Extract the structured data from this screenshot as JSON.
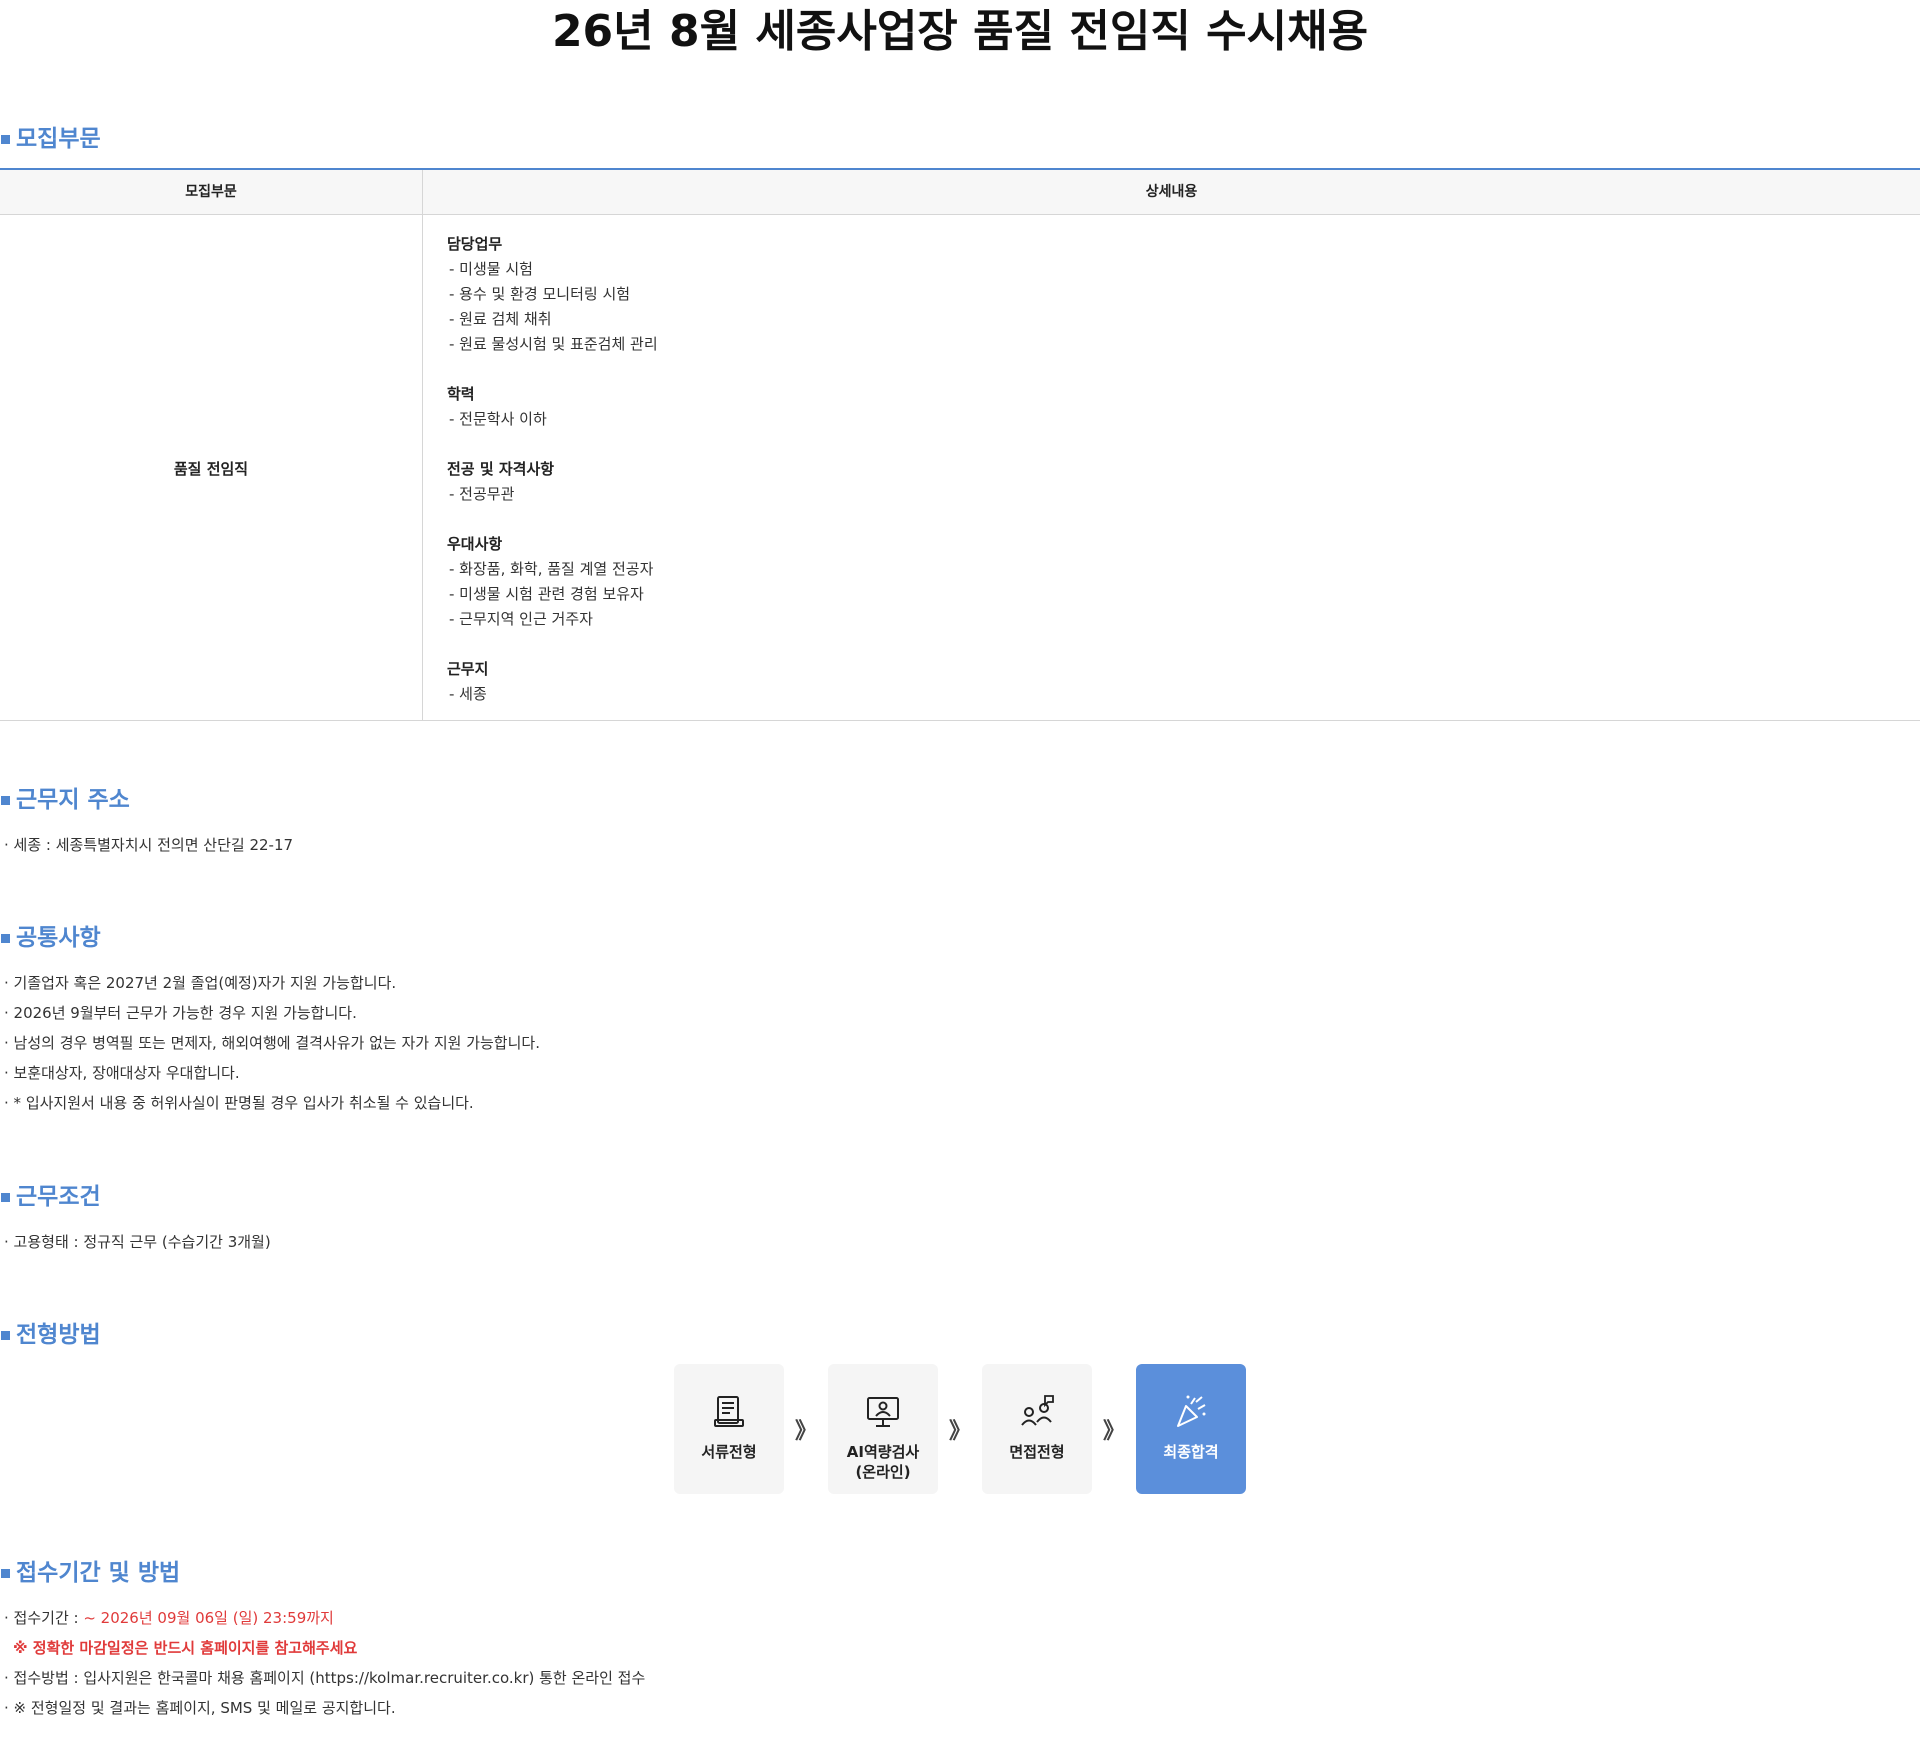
{
  "page": {
    "title": "26년 8월 세종사업장 품질 전임직 수시채용"
  },
  "sections": {
    "recruit": "모집부문",
    "address": "근무지 주소",
    "common": "공통사항",
    "conditions": "근무조건",
    "process": "전형방법",
    "apply": "접수기간 및 방법"
  },
  "recruit_table": {
    "headers": [
      "모집부문",
      "상세내용"
    ],
    "department": "품질 전임직",
    "details": [
      {
        "title": "담당업무",
        "items": [
          "- 미생물 시험",
          "- 용수 및 환경 모니터링 시험",
          "- 원료 검체 채취",
          "- 원료 물성시험 및 표준검체 관리"
        ]
      },
      {
        "title": "학력",
        "items": [
          "- 전문학사 이하"
        ]
      },
      {
        "title": "전공 및 자격사항",
        "items": [
          "- 전공무관"
        ]
      },
      {
        "title": "우대사항",
        "items": [
          "- 화장품, 화학, 품질 계열 전공자",
          "- 미생물 시험 관련 경험 보유자",
          "- 근무지역 인근 거주자"
        ]
      },
      {
        "title": "근무지",
        "items": [
          "- 세종"
        ]
      }
    ]
  },
  "address": {
    "items": [
      "세종 : 세종특별자치시 전의면 산단길 22-17"
    ]
  },
  "common": {
    "items": [
      "기졸업자 혹은 2027년 2월 졸업(예정)자가 지원 가능합니다.",
      "2026년 9월부터 근무가 가능한 경우 지원 가능합니다.",
      "남성의 경우 병역필 또는 면제자, 해외여행에 결격사유가 없는 자가 지원 가능합니다.",
      "보훈대상자, 장애대상자 우대합니다.",
      " * 입사지원서 내용 중 허위사실이 판명될 경우 입사가 취소될 수 있습니다."
    ]
  },
  "conditions": {
    "items": [
      "고용형태 : 정규직 근무 (수습기간 3개월)"
    ]
  },
  "process": {
    "arrow": "》",
    "steps": [
      {
        "label": "서류전형",
        "icon": "document-icon"
      },
      {
        "label": "AI역량검사",
        "label2": "(온라인)",
        "icon": "monitor-person-icon"
      },
      {
        "label": "면접전형",
        "icon": "interview-icon"
      },
      {
        "label": "최종합격",
        "icon": "party-popper-icon"
      }
    ],
    "final_color": "#5b8fdb"
  },
  "apply": {
    "period_label": "접수기간 : ",
    "period_value": "~ 2026년 09월 06일 (일) 23:59까지",
    "deadline_note": "※ 정확한 마감일정은 반드시 홈페이지를 참고해주세요",
    "method": "접수방법 : 입사지원은 한국콜마 채용 홈페이지 (https://kolmar.recruiter.co.kr) 통한 온라인 접수",
    "notice": "※ 전형일정 및 결과는 홈페이지, SMS 및 메일로 공지합니다."
  },
  "colors": {
    "accent": "#4f86cf",
    "highlight": "#e03a3a"
  }
}
